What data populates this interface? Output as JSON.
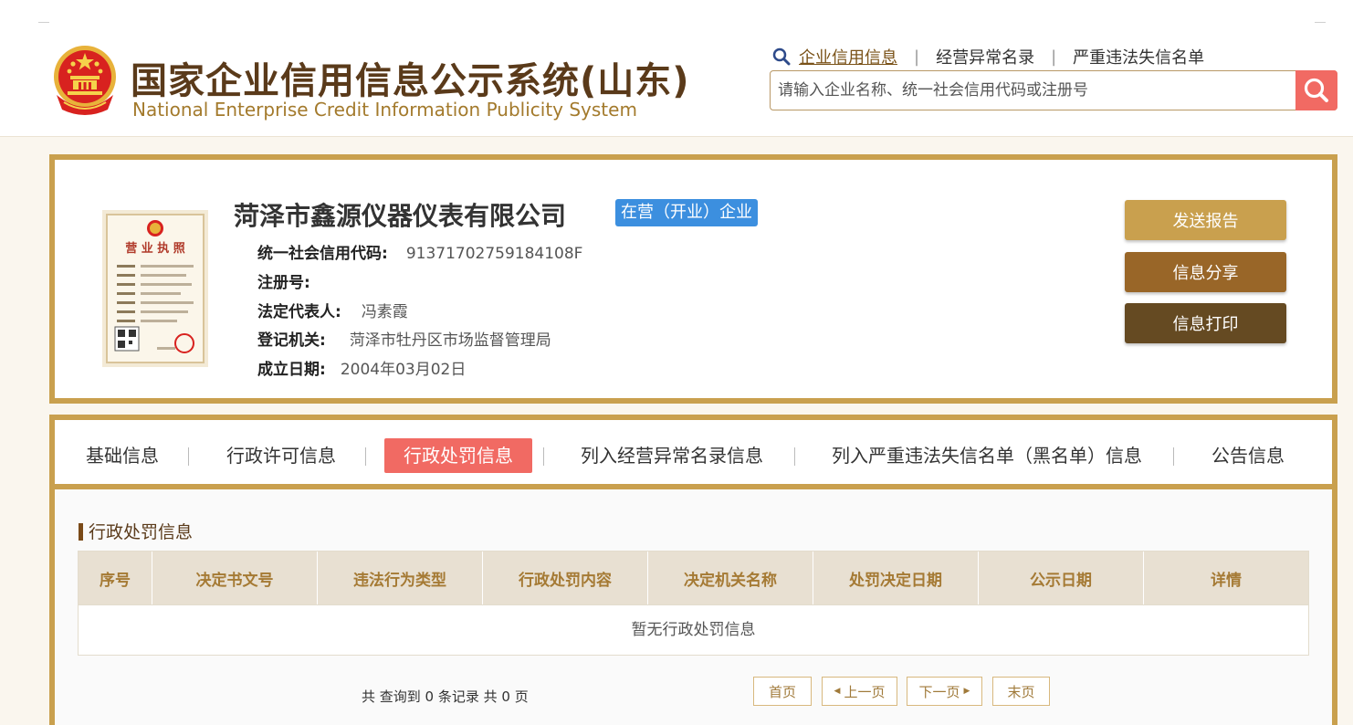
{
  "header": {
    "title_cn": "国家企业信用信息公示系统(山东)",
    "title_en": "National Enterprise Credit Information Publicity System",
    "nav": {
      "icon": "search-icon",
      "items": [
        "企业信用信息",
        "经营异常名录",
        "严重违法失信名单"
      ]
    },
    "search": {
      "placeholder": "请输入企业名称、统一社会信用代码或注册号",
      "value": ""
    }
  },
  "company": {
    "name": "菏泽市鑫源仪器仪表有限公司",
    "status": "在营（开业）企业",
    "license_image": {
      "title": "营 业 执 照"
    },
    "fields": [
      {
        "label": "统一社会信用代码:",
        "value": "91371702759184108F"
      },
      {
        "label": "注册号:",
        "value": ""
      },
      {
        "label": "法定代表人:",
        "value": "冯素霞"
      },
      {
        "label": "登记机关:",
        "value": "菏泽市牡丹区市场监督管理局"
      },
      {
        "label": "成立日期:",
        "value": "2004年03月02日"
      }
    ],
    "actions": [
      "发送报告",
      "信息分享",
      "信息打印"
    ]
  },
  "tabs": {
    "items": [
      "基础信息",
      "行政许可信息",
      "行政处罚信息",
      "列入经营异常名录信息",
      "列入严重违法失信名单（黑名单）信息",
      "公告信息"
    ],
    "active": "行政处罚信息"
  },
  "section": {
    "title": "行政处罚信息",
    "columns": [
      "序号",
      "决定书文号",
      "违法行为类型",
      "行政处罚内容",
      "决定机关名称",
      "处罚决定日期",
      "公示日期",
      "详情"
    ],
    "empty_text": "暂无行政处罚信息"
  },
  "pagination": {
    "summary": "共 查询到 0 条记录 共 0 页",
    "first": "首页",
    "prev": "上一页",
    "next": "下一页",
    "last": "末页"
  },
  "colors": {
    "gold_border": "#c9a04e",
    "active_tab": "#f16a63",
    "status_badge": "#3c8fdf",
    "btn_send": "#c9a04e",
    "btn_share": "#996628",
    "btn_print": "#654a22",
    "header_text": "#a57a34"
  }
}
